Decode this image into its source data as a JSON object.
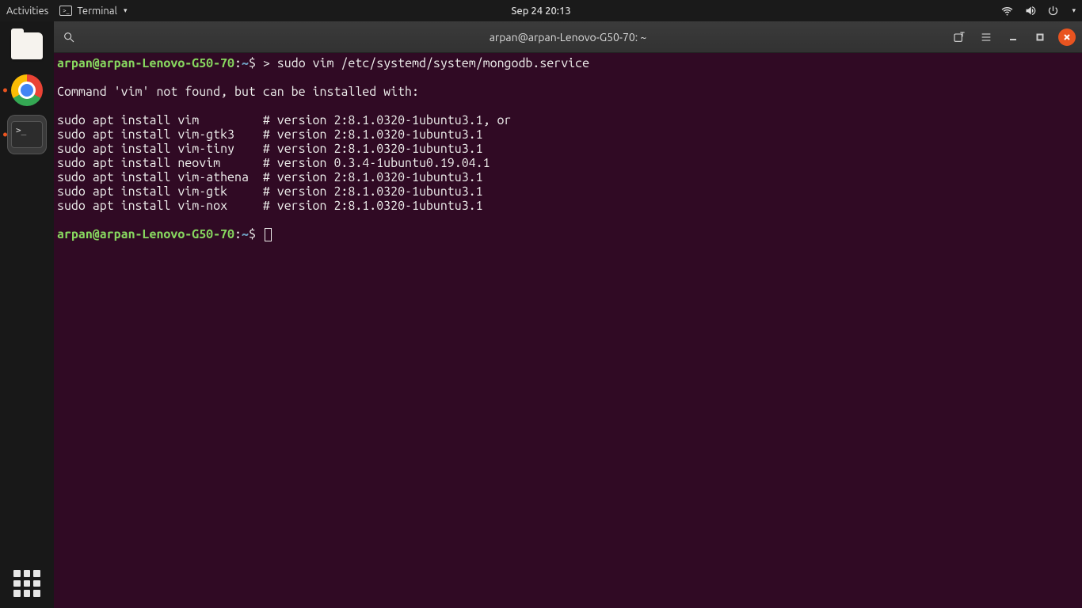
{
  "panel": {
    "activities": "Activities",
    "app_menu": "Terminal",
    "clock": "Sep 24  20:13"
  },
  "dock": {
    "items": [
      {
        "name": "files"
      },
      {
        "name": "chrome"
      },
      {
        "name": "terminal"
      }
    ]
  },
  "window": {
    "title": "arpan@arpan-Lenovo-G50-70: ~"
  },
  "terminal": {
    "prompt_user_host": "arpan@arpan-Lenovo-G50-70",
    "prompt_path": "~",
    "prompt_symbol": "$",
    "command": "> sudo vim /etc/systemd/system/mongodb.service",
    "output_lines": [
      "",
      "Command 'vim' not found, but can be installed with:",
      "",
      "sudo apt install vim         # version 2:8.1.0320-1ubuntu3.1, or",
      "sudo apt install vim-gtk3    # version 2:8.1.0320-1ubuntu3.1",
      "sudo apt install vim-tiny    # version 2:8.1.0320-1ubuntu3.1",
      "sudo apt install neovim      # version 0.3.4-1ubuntu0.19.04.1",
      "sudo apt install vim-athena  # version 2:8.1.0320-1ubuntu3.1",
      "sudo apt install vim-gtk     # version 2:8.1.0320-1ubuntu3.1",
      "sudo apt install vim-nox     # version 2:8.1.0320-1ubuntu3.1",
      ""
    ]
  }
}
